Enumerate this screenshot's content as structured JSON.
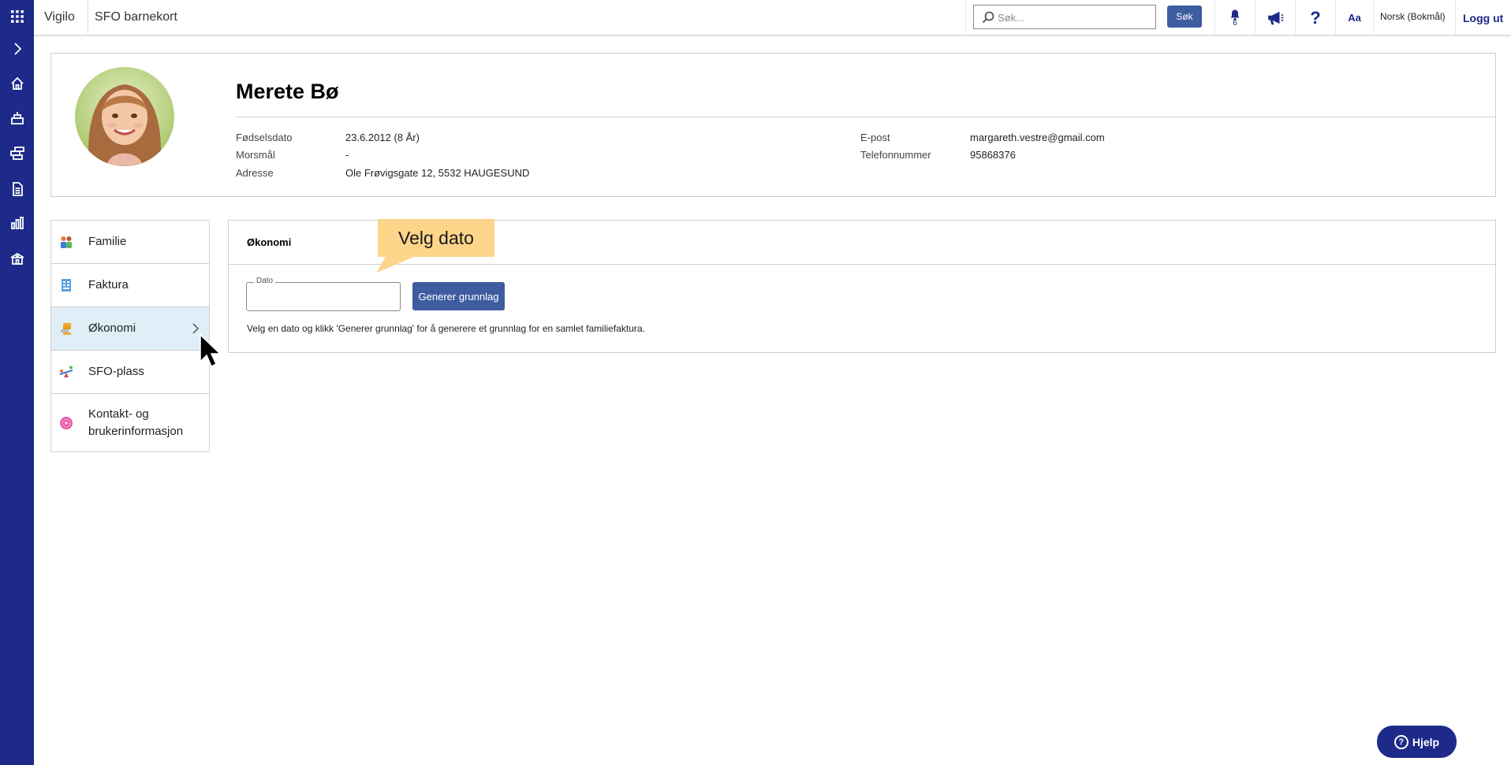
{
  "topbar": {
    "brand": "Vigilo",
    "app_title": "SFO barnekort",
    "search_placeholder": "Søk...",
    "search_button": "Søk",
    "notification_count": "6",
    "font_size_label": "Aa",
    "language": "Norsk (Bokmål)",
    "logout": "Logg ut"
  },
  "rail": {
    "icons": [
      "apps-grid-icon",
      "expand-chevron-icon",
      "home-icon",
      "class-icon",
      "finance-coins-icon",
      "document-icon",
      "bar-chart-icon",
      "school-building-icon"
    ]
  },
  "profile": {
    "name": "Merete Bø",
    "fields_left": [
      {
        "label": "Fødselsdato",
        "value": "23.6.2012 (8 År)"
      },
      {
        "label": "Morsmål",
        "value": "-"
      },
      {
        "label": "Adresse",
        "value": "Ole Frøvigsgate 12, 5532 HAUGESUND"
      }
    ],
    "fields_right": [
      {
        "label": "E-post",
        "value": "margareth.vestre@gmail.com"
      },
      {
        "label": "Telefonnummer",
        "value": "95868376"
      }
    ]
  },
  "side_menu": {
    "items": [
      {
        "label": "Familie",
        "icon": "family-icon"
      },
      {
        "label": "Faktura",
        "icon": "invoice-icon"
      },
      {
        "label": "Økonomi",
        "icon": "coins-icon",
        "active": true
      },
      {
        "label": "SFO-plass",
        "icon": "seesaw-icon"
      },
      {
        "label": "Kontakt- og brukerinformasjon",
        "icon": "contact-icon"
      }
    ]
  },
  "panel": {
    "title": "Økonomi",
    "date_label": "Dato",
    "date_value": "",
    "generate_button": "Generer grunnlag",
    "help_text": "Velg en dato og klikk 'Generer grunnlag' for å generere et grunnlag for en samlet familiefaktura."
  },
  "callout": {
    "text": "Velg dato"
  },
  "help_button": {
    "label": "Hjelp"
  },
  "colors": {
    "rail": "#1d2a8a",
    "button": "#3e5da0",
    "active_menu": "#dfeef7",
    "callout": "#fcd48a"
  }
}
